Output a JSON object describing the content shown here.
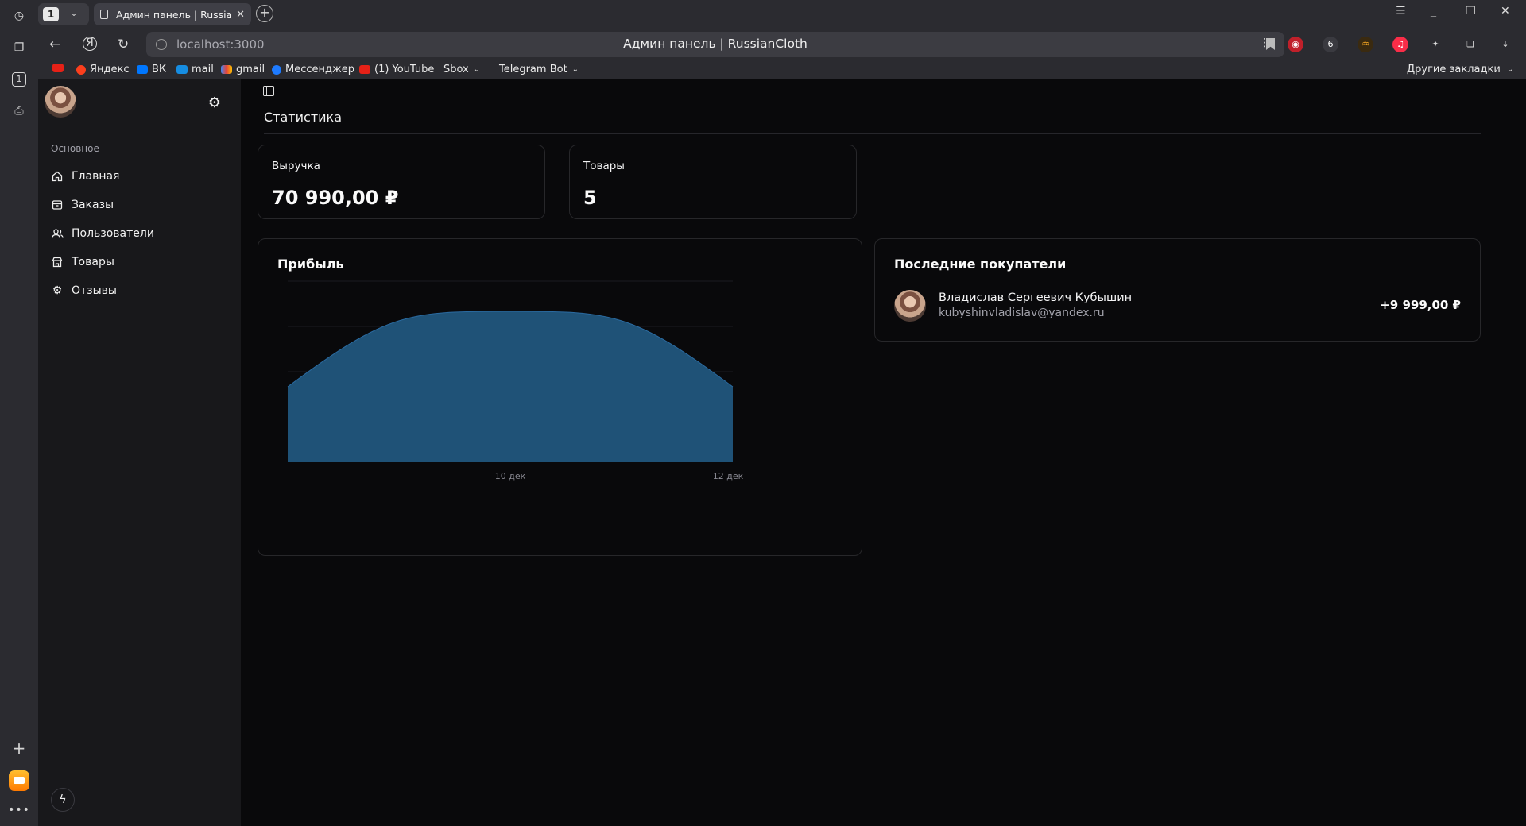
{
  "browser": {
    "tab_count": "1",
    "tab_title": "Админ панель | RussianCloth",
    "url": "localhost:3000",
    "page_title": "Админ панель | RussianCloth",
    "bookmarks": [
      {
        "label": "",
        "icon": "youtube-icon",
        "color": "#e62117"
      },
      {
        "label": "Яндекс",
        "icon": "yandex-icon",
        "color": "#fc3f1d"
      },
      {
        "label": "ВК",
        "icon": "vk-icon",
        "color": "#0077ff"
      },
      {
        "label": "mail",
        "icon": "mail-icon",
        "color": "#168de2"
      },
      {
        "label": "gmail",
        "icon": "gmail-icon",
        "color": "#ea4335"
      },
      {
        "label": "Мессенджер",
        "icon": "messenger-icon",
        "color": "#1e7bff"
      },
      {
        "label": "(1) YouTube",
        "icon": "youtube-icon",
        "color": "#e62117"
      },
      {
        "label": "Sbox",
        "icon": "folder-icon",
        "color": ""
      },
      {
        "label": "Telegram Bot",
        "icon": "folder-icon",
        "color": ""
      }
    ],
    "other_bookmarks": "Другие закладки"
  },
  "sidebar": {
    "section_label": "Основное",
    "items": [
      {
        "label": "Главная",
        "icon": "home-icon"
      },
      {
        "label": "Заказы",
        "icon": "archive-icon"
      },
      {
        "label": "Пользователи",
        "icon": "users-icon"
      },
      {
        "label": "Товары",
        "icon": "store-icon"
      },
      {
        "label": "Отзывы",
        "icon": "gear-icon"
      }
    ]
  },
  "main": {
    "title": "Статистика",
    "stats": [
      {
        "label": "Выручка",
        "value": "70 990,00 ₽"
      },
      {
        "label": "Товары",
        "value": "5"
      }
    ],
    "profit_title": "Прибыль",
    "buyers_title": "Последние покупатели",
    "buyers": [
      {
        "name": "Владислав Сергеевич Кубышин",
        "email": "kubyshinvladislav@yandex.ru",
        "amount": "+9 999,00 ₽"
      }
    ]
  },
  "chart_data": {
    "type": "area",
    "x": [
      "",
      "10 дек",
      "12 дек"
    ],
    "xlabels": [
      "10 дек",
      "12 дек"
    ],
    "series": [
      {
        "values": [
          0.5,
          1.0,
          0.5
        ]
      }
    ],
    "ylim": [
      0,
      1.2
    ],
    "grid": true,
    "color": "#1f5277",
    "stroke": "#2a6aa0"
  }
}
